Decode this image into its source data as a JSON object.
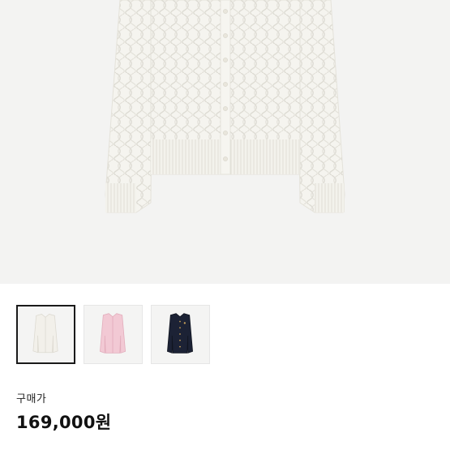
{
  "product": {
    "image_icon": "cable-knit-cardigan-ivory",
    "colors": [
      {
        "name": "ivory",
        "swatch": "#f2f0ea",
        "selected": true
      },
      {
        "name": "pink",
        "swatch": "#f2c9d4",
        "selected": false
      },
      {
        "name": "navy",
        "swatch": "#1c2235",
        "selected": false
      }
    ]
  },
  "price": {
    "label": "구매가",
    "value": "169,000원"
  },
  "colors": {
    "hero_background": "#f3f3f2",
    "selected_border": "#1a1a1a"
  }
}
